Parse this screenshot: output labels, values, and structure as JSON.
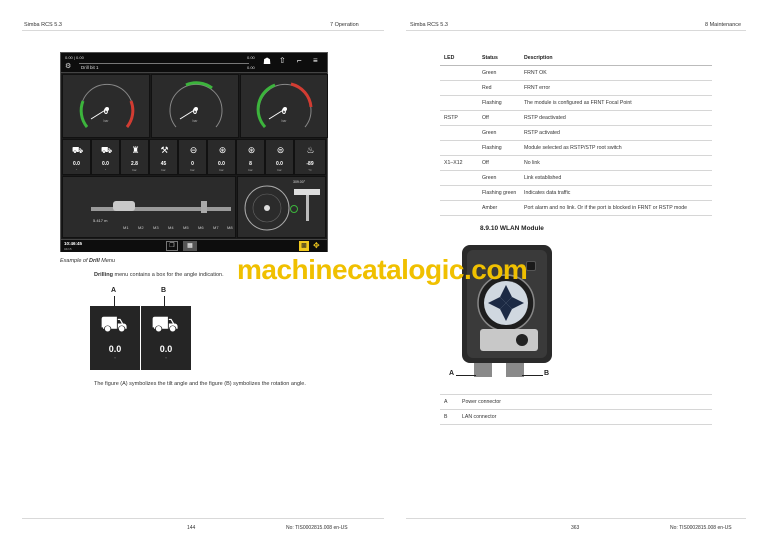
{
  "header": {
    "left_title": "Simba RCS 5.3",
    "left_chapter": "7 Operation",
    "right_title": "Simba RCS 5.3",
    "right_chapter": "8 Maintenance"
  },
  "hmi": {
    "top_left_value": "0.00 | 0.00",
    "top_right_value": "0.00",
    "drill_label": "Drill bit 1",
    "drill_value": "0.00",
    "gauges": [
      {
        "value": "0",
        "unit": "bar"
      },
      {
        "value": "0",
        "unit": "bar"
      },
      {
        "value": "0",
        "unit": "bar"
      }
    ],
    "tiles": [
      {
        "value": "0.0",
        "unit": "°"
      },
      {
        "value": "0.0",
        "unit": "°"
      },
      {
        "value": "2.8",
        "unit": "bar"
      },
      {
        "value": "45",
        "unit": "bar"
      },
      {
        "value": "0",
        "unit": "bar"
      },
      {
        "value": "0.0",
        "unit": "bar"
      },
      {
        "value": "8",
        "unit": "bar"
      },
      {
        "value": "0.0",
        "unit": "bar"
      },
      {
        "value": "-89",
        "unit": "°C"
      }
    ],
    "position_value": "5.417 m",
    "rotation_value": "309.00°",
    "m_buttons": [
      "M1",
      "M2",
      "M3",
      "M4",
      "M5",
      "M6",
      "M7",
      "M8"
    ],
    "clock": "10:46:45",
    "date": "04/15"
  },
  "caption": {
    "prefix": "Example of ",
    "bold": "Drill",
    "suffix": " Menu"
  },
  "drilling_para": {
    "bold": "Drilling",
    "rest": " menu contains a box for the angle indication."
  },
  "angle_figure": {
    "label_a": "A",
    "label_b": "B",
    "value_a": "0.0",
    "unit_a": "°",
    "value_b": "0.0",
    "unit_b": "°"
  },
  "figure_para": "The figure (A) symbolizes the tilt angle and the figure (B) symbolizes the rotation angle.",
  "led_table": {
    "headers": [
      "LED",
      "Status",
      "Description"
    ],
    "rows": [
      [
        "",
        "Green",
        "FRNT OK"
      ],
      [
        "",
        "Red",
        "FRNT error"
      ],
      [
        "",
        "Flashing",
        "The module is configured as FRNT Focal Point"
      ],
      [
        "RSTP",
        "Off",
        "RSTP deactivated"
      ],
      [
        "",
        "Green",
        "RSTP activated"
      ],
      [
        "",
        "Flashing",
        "Module selected as RSTP/STP root switch"
      ],
      [
        "X1–X12",
        "Off",
        "No link"
      ],
      [
        "",
        "Green",
        "Link established"
      ],
      [
        "",
        "Flashing green",
        "Indicates data traffic"
      ],
      [
        "",
        "Amber",
        "Port alarm and no link. Or if the port is blocked in FRNT or RSTP mode"
      ]
    ]
  },
  "wlan": {
    "title": "8.9.10 WLAN Module",
    "label_a": "A",
    "label_b": "B"
  },
  "legend_table": {
    "rows": [
      [
        "A",
        "Power connector"
      ],
      [
        "B",
        "LAN connector"
      ]
    ]
  },
  "watermark": "machinecatalogic.com",
  "footer": {
    "left_page": "144",
    "left_doc": "No: TIS0002815.008 en-US",
    "right_page": "363",
    "right_doc": "No: TIS0002815.008 en-US"
  },
  "colors": {
    "gauge_green": "#3cb43c",
    "gauge_red": "#d23c32",
    "hmi_yellow": "#f0c81e",
    "watermark": "#f0c000"
  }
}
